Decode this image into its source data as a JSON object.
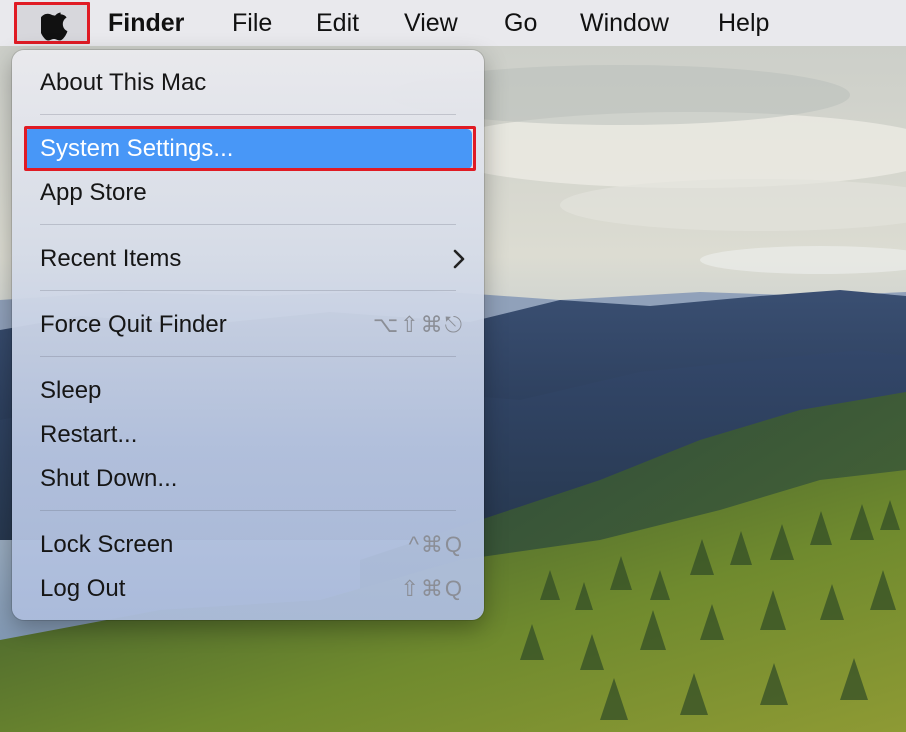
{
  "menubar": {
    "apple_icon": "apple-logo-icon",
    "items": [
      "Finder",
      "File",
      "Edit",
      "View",
      "Go",
      "Window",
      "Help"
    ]
  },
  "apple_menu": {
    "items": [
      {
        "label": "About This Mac"
      },
      {
        "label": "System Settings...",
        "selected": true
      },
      {
        "label": "App Store"
      },
      {
        "label": "Recent Items",
        "submenu_icon": "chevron-right-icon"
      },
      {
        "label": "Force Quit Finder",
        "shortcut": "⌥⇧⌘⎋"
      },
      {
        "label": "Sleep"
      },
      {
        "label": "Restart..."
      },
      {
        "label": "Shut Down..."
      },
      {
        "label": "Lock Screen",
        "shortcut": "^⌘Q"
      },
      {
        "label": "Log Out",
        "shortcut": "⇧⌘Q"
      }
    ]
  },
  "colors": {
    "selection": "#4897f7",
    "annotation_frame": "#e01b24"
  }
}
